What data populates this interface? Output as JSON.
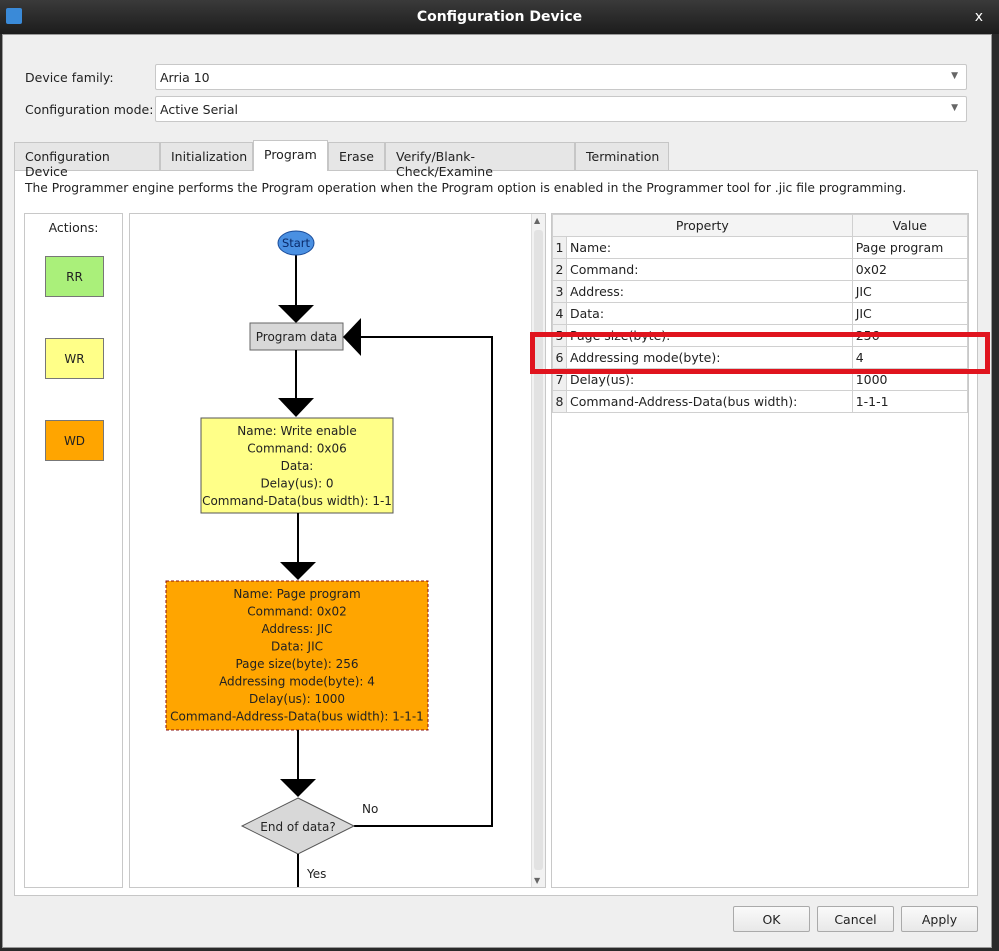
{
  "window": {
    "title": "Configuration Device",
    "close": "x"
  },
  "device_family": {
    "label": "Device family:",
    "value": "Arria 10"
  },
  "config_mode": {
    "label": "Configuration mode:",
    "value": "Active Serial"
  },
  "tabs": [
    "Configuration Device",
    "Initialization",
    "Program",
    "Erase",
    "Verify/Blank-Check/Examine",
    "Termination"
  ],
  "active_tab": "Program",
  "description": "The Programmer engine performs the Program operation when the Program option is enabled in the Programmer tool for .jic file programming.",
  "actions": {
    "label": "Actions:",
    "items": [
      {
        "label": "RR",
        "color": "#aaf07a"
      },
      {
        "label": "WR",
        "color": "#ffff88"
      },
      {
        "label": "WD",
        "color": "#ffa500"
      }
    ]
  },
  "flow": {
    "start": "Start",
    "program_data": "Program data",
    "write_enable": [
      "Name: Write enable",
      "Command: 0x06",
      "Data:",
      "Delay(us): 0",
      "Command-Data(bus width): 1-1"
    ],
    "page_program": [
      "Name: Page program",
      "Command: 0x02",
      "Address: JIC",
      "Data: JIC",
      "Page size(byte): 256",
      "Addressing mode(byte): 4",
      "Delay(us): 1000",
      "Command-Address-Data(bus width): 1-1-1"
    ],
    "decision": "End of data?",
    "no": "No",
    "yes": "Yes"
  },
  "table": {
    "headers": [
      "Property",
      "Value"
    ],
    "rows": [
      {
        "n": "1",
        "p": "Name:",
        "v": "Page program"
      },
      {
        "n": "2",
        "p": "Command:",
        "v": "0x02"
      },
      {
        "n": "3",
        "p": "Address:",
        "v": "JIC"
      },
      {
        "n": "4",
        "p": "Data:",
        "v": "JIC"
      },
      {
        "n": "5",
        "p": "Page size(byte):",
        "v": "256"
      },
      {
        "n": "6",
        "p": "Addressing mode(byte):",
        "v": "4"
      },
      {
        "n": "7",
        "p": "Delay(us):",
        "v": "1000"
      },
      {
        "n": "8",
        "p": "Command-Address-Data(bus width):",
        "v": "1-1-1"
      }
    ]
  },
  "buttons": {
    "ok": "OK",
    "cancel": "Cancel",
    "apply": "Apply"
  },
  "highlight_color": "#e0141e"
}
